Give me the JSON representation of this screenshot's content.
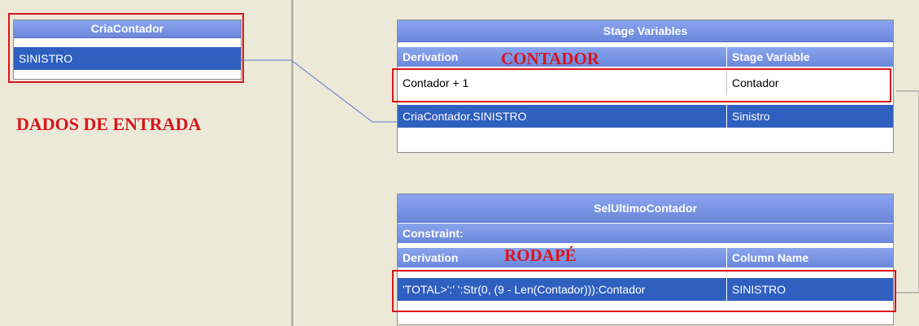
{
  "input_box": {
    "title": "CriaContador",
    "rows": [
      "SINISTRO"
    ]
  },
  "annotations": {
    "input_label": "DADOS DE ENTRADA",
    "contador_label": "CONTADOR",
    "rodape_label": "RODAPÉ"
  },
  "stage_vars": {
    "title": "Stage Variables",
    "col_derivation": "Derivation",
    "col_stage_variable": "Stage Variable",
    "rows": [
      {
        "derivation": "Contador + 1",
        "variable": "Contador"
      },
      {
        "derivation": "CriaContador.SINISTRO",
        "variable": "Sinistro"
      }
    ]
  },
  "output_box": {
    "title": "SelUltimoContador",
    "constraint_label": "Constraint:",
    "col_derivation": "Derivation",
    "col_column_name": "Column Name",
    "rows": [
      {
        "derivation": "'TOTAL>':' ':Str(0, (9 - Len(Contador))):Contador",
        "column": "SINISTRO"
      }
    ]
  },
  "colors": {
    "header_blue": "#7b96e3",
    "selected_blue": "#2f5fbf",
    "annotation_red": "#d9141c",
    "background": "#ece9d8"
  }
}
